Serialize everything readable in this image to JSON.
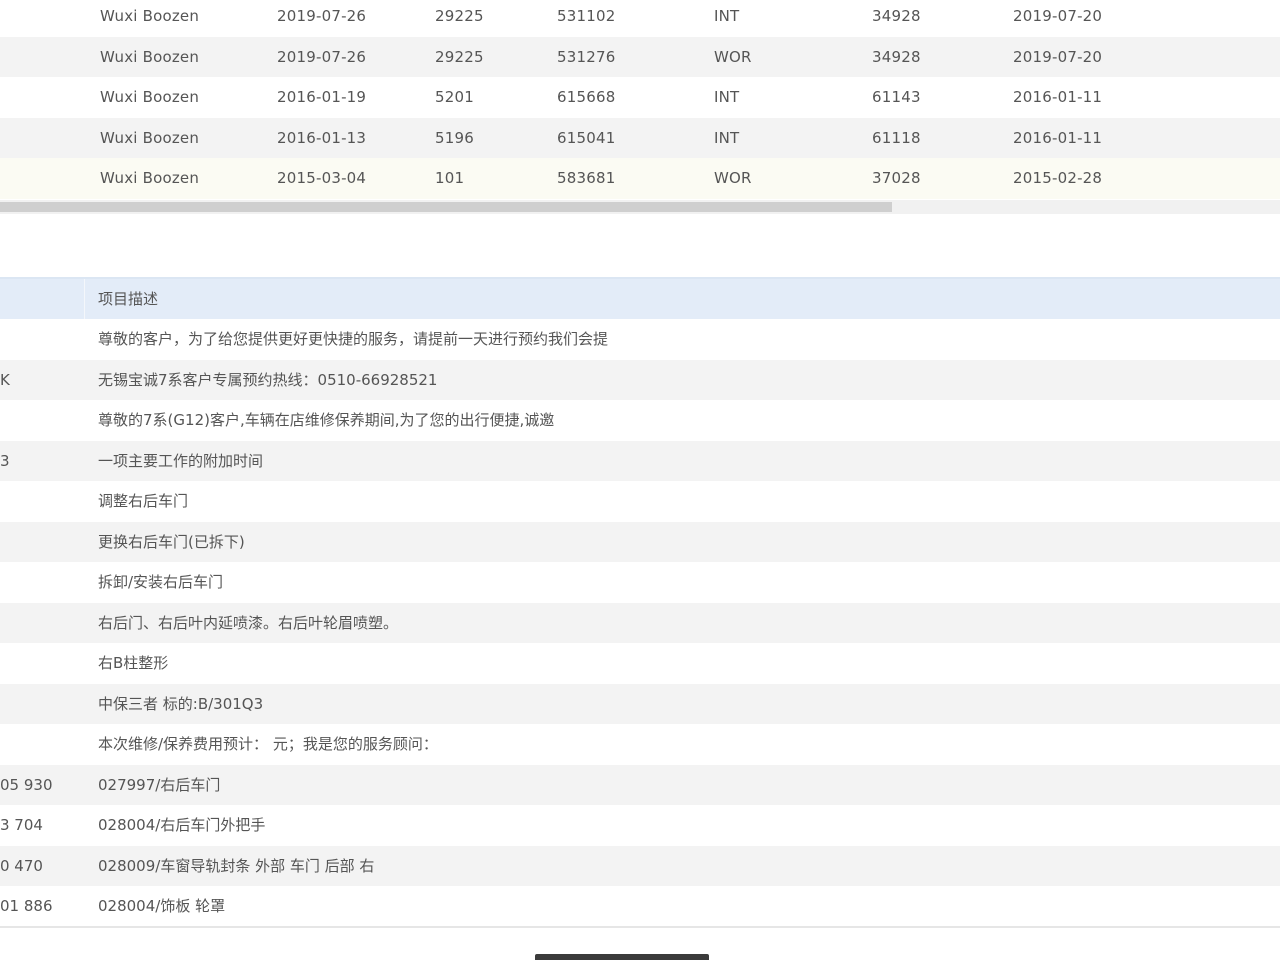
{
  "top_table": {
    "rows": [
      [
        "Wuxi Boozen",
        "2019-07-26",
        "29225",
        "531102",
        "INT",
        "34928",
        "2019-07-20"
      ],
      [
        "Wuxi Boozen",
        "2019-07-26",
        "29225",
        "531276",
        "WOR",
        "34928",
        "2019-07-20"
      ],
      [
        "Wuxi Boozen",
        "2016-01-19",
        "5201",
        "615668",
        "INT",
        "61143",
        "2016-01-11"
      ],
      [
        "Wuxi Boozen",
        "2016-01-13",
        "5196",
        "615041",
        "INT",
        "61118",
        "2016-01-11"
      ],
      [
        "Wuxi Boozen",
        "2015-03-04",
        "101",
        "583681",
        "WOR",
        "37028",
        "2015-02-28"
      ]
    ]
  },
  "bottom_table": {
    "header_desc": "项目描述",
    "rows": [
      {
        "code": "",
        "desc": "尊敬的客户，为了给您提供更好更快捷的服务，请提前一天进行预约我们会提"
      },
      {
        "code": "K",
        "desc": "无锡宝诚7系客户专属预约热线：0510-66928521"
      },
      {
        "code": "",
        "desc": "尊敬的7系(G12)客户,车辆在店维修保养期间,为了您的出行便捷,诚邀"
      },
      {
        "code": "3",
        "desc": "一项主要工作的附加时间"
      },
      {
        "code": "",
        "desc": "调整右后车门"
      },
      {
        "code": "",
        "desc": "更换右后车门(已拆下)"
      },
      {
        "code": "",
        "desc": "拆卸/安装右后车门"
      },
      {
        "code": "",
        "desc": "右后门、右后叶内延喷漆。右后叶轮眉喷塑。"
      },
      {
        "code": "",
        "desc": "右B柱整形"
      },
      {
        "code": "",
        "desc": "中保三者 标的:B/301Q3"
      },
      {
        "code": "",
        "desc": "本次维修/保养费用预计： 元；我是您的服务顾问："
      },
      {
        "code": "05 930",
        "desc": "027997/右后车门"
      },
      {
        "code": "3 704",
        "desc": "028004/右后车门外把手"
      },
      {
        "code": "0 470",
        "desc": "028009/车窗导轨封条 外部 车门 后部 右"
      },
      {
        "code": "01 886",
        "desc": "028004/饰板 轮罩"
      }
    ]
  }
}
